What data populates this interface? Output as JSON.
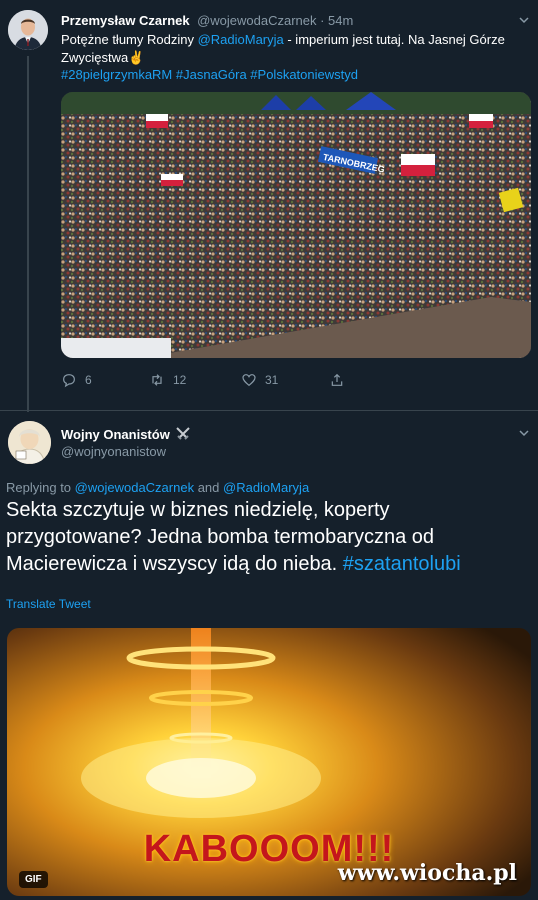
{
  "tweet1": {
    "author_name": "Przemysław Czarnek",
    "handle_time": "@wojewodaCzarnek · 54m",
    "text_a": "Potężne tłumy Rodziny ",
    "mention": "@RadioMaryja",
    "text_b": " - imperium jest tutaj. Na Jasnej Górze Zwycięstwa",
    "emoji": "✌",
    "hashtags": "#28pielgrzymkaRM #JasnaGóra #Polskatoniewstyd",
    "photo_icon": "crowd-photo",
    "banner_text": "TARNOBRZEG",
    "replies": "6",
    "retweets": "12",
    "likes": "31"
  },
  "tweet2": {
    "author_name": "Wojny Onanistów",
    "badge_icon": "crossed-swords-icon",
    "handle": "@wojnyonanistow",
    "replying_prefix": "Replying to ",
    "replying_to_1": "@wojewodaCzarnek",
    "replying_and": " and ",
    "replying_to_2": "@RadioMaryja",
    "text": "Sekta szczytuje w biznes niedzielę, koperty przygotowane? Jedna bomba termobaryczna od Macierewicza i wszyscy idą do nieba.  ",
    "hashtag": "#szatantolubi",
    "translate": "Translate Tweet",
    "gif_caption": "KABOOOM!!!",
    "gif_badge": "GIF"
  },
  "watermark": "www.wiocha.pl",
  "colors": {
    "background": "#15202b",
    "link": "#1da1f2",
    "muted": "#8899a6"
  }
}
